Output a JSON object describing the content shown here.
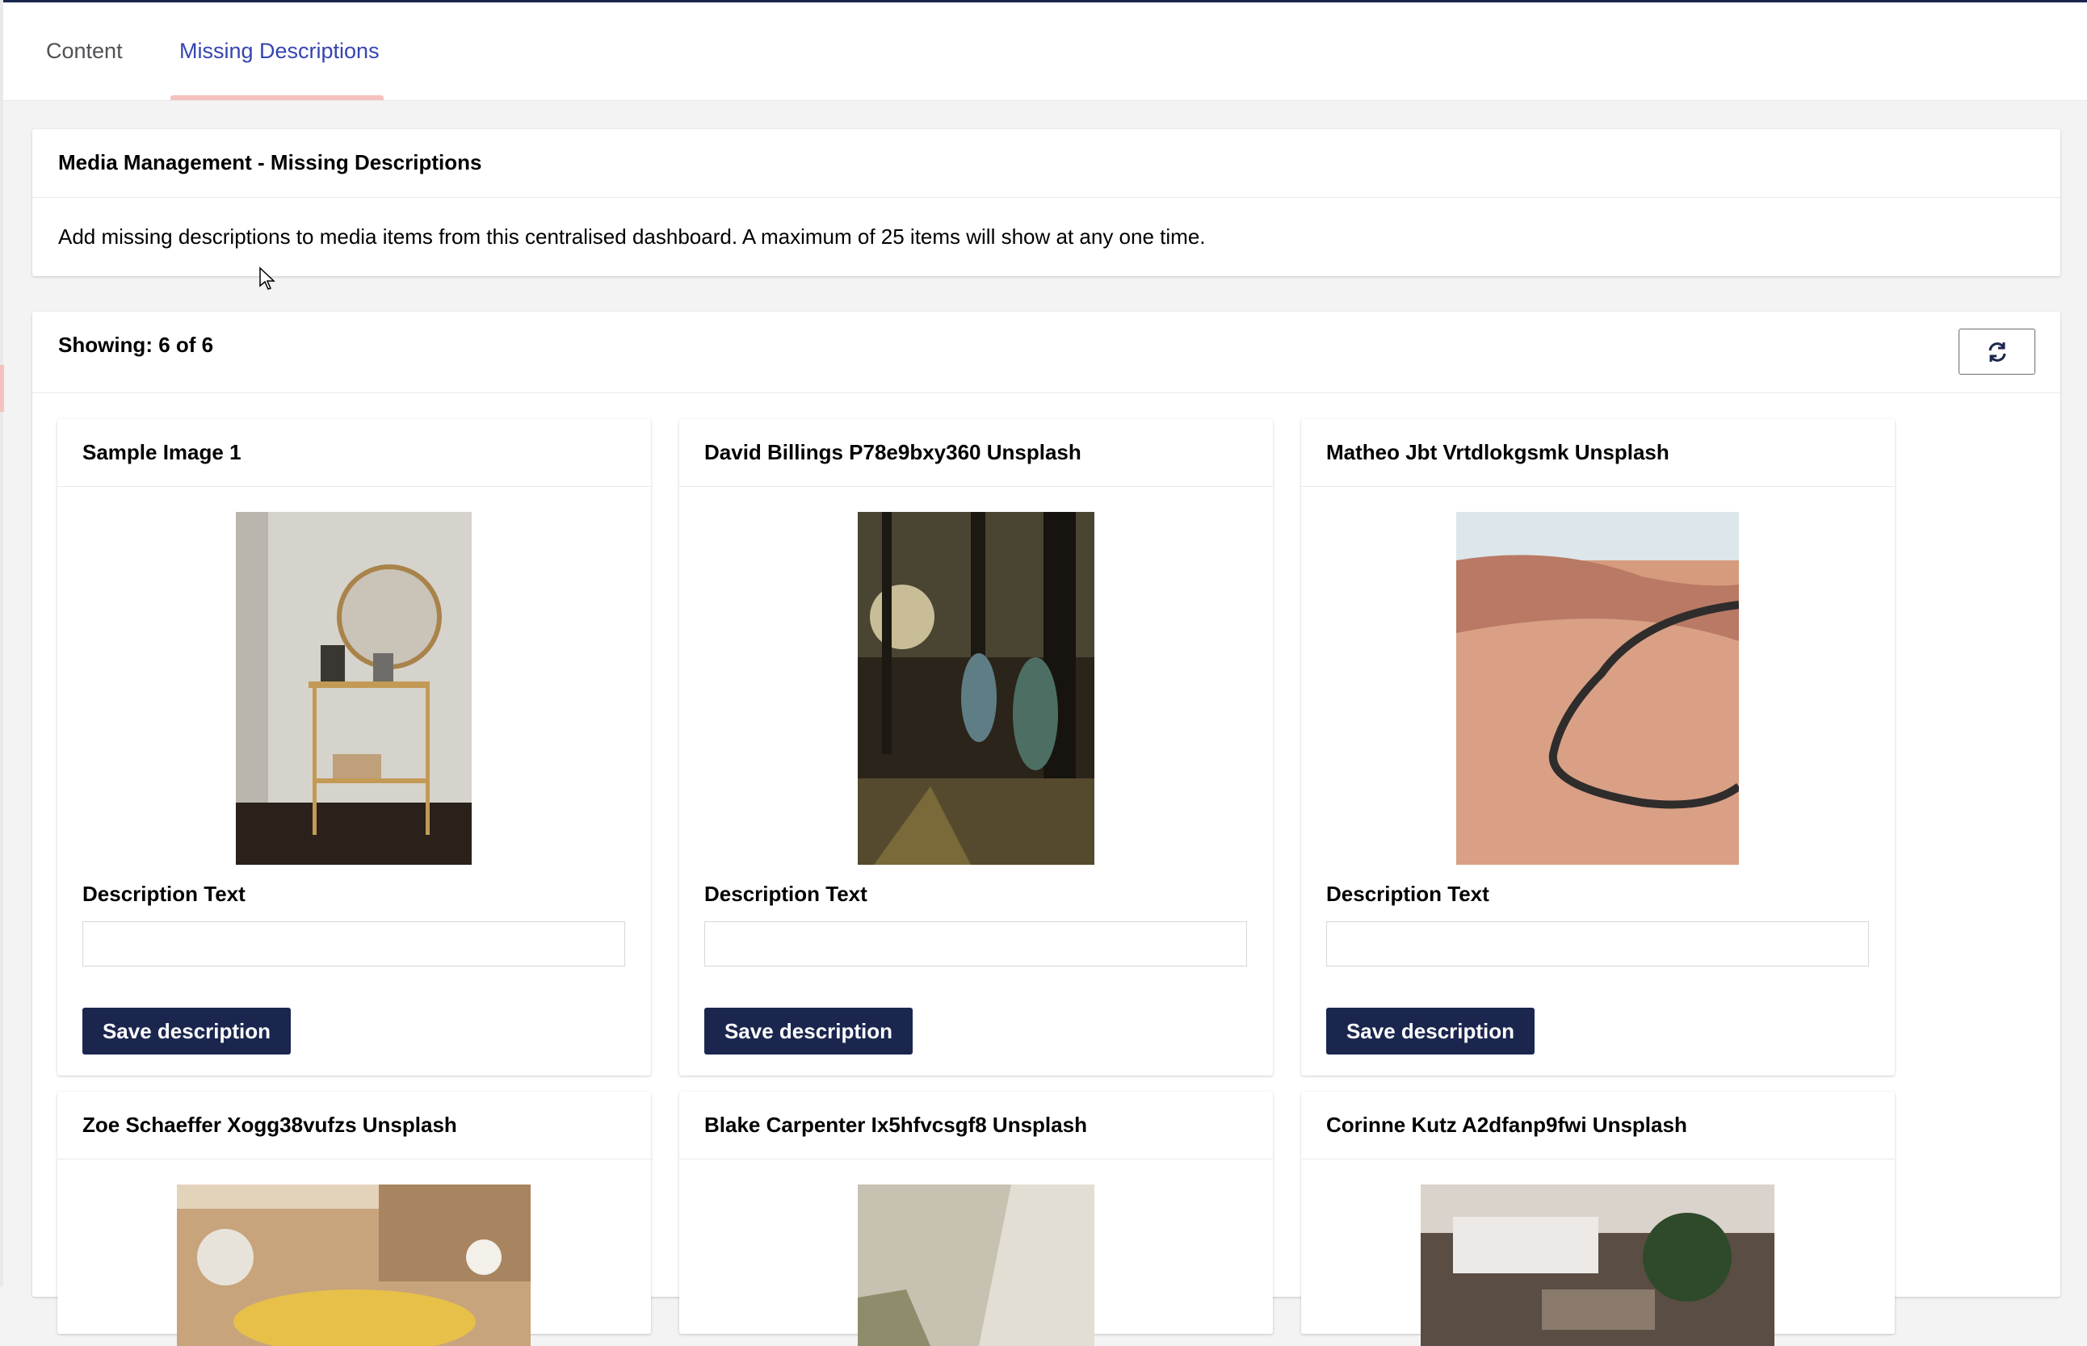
{
  "tabs": {
    "content_label": "Content",
    "missing_label": "Missing Descriptions"
  },
  "intro": {
    "title": "Media Management - Missing Descriptions",
    "description": "Add missing descriptions to media items from this centralised dashboard. A maximum of 25 items will show at any one time."
  },
  "list": {
    "showing_label": "Showing:",
    "showing_count": "6 of 6",
    "refresh_icon": "refresh-icon"
  },
  "cards": [
    {
      "title": "Sample Image 1",
      "label": "Description Text",
      "value": "",
      "save_label": "Save description",
      "image": "photo-mirror-cart"
    },
    {
      "title": "David Billings P78e9bxy360 Unsplash",
      "label": "Description Text",
      "value": "",
      "save_label": "Save description",
      "image": "photo-forest-walk"
    },
    {
      "title": "Matheo Jbt Vrtdlokgsmk Unsplash",
      "label": "Description Text",
      "value": "",
      "save_label": "Save description",
      "image": "photo-desert-road"
    },
    {
      "title": "Zoe Schaeffer Xogg38vufzs Unsplash",
      "image": "photo-chicks-box"
    },
    {
      "title": "Blake Carpenter Ix5hfvcsgf8 Unsplash",
      "image": "photo-wall-corner"
    },
    {
      "title": "Corinne Kutz A2dfanp9fwi Unsplash",
      "image": "photo-desk-plant"
    }
  ],
  "colors": {
    "primary": "#1b264f",
    "tab_active": "#3544b1",
    "tab_indicator": "#f5c1bc",
    "background": "#f4f3f3"
  }
}
